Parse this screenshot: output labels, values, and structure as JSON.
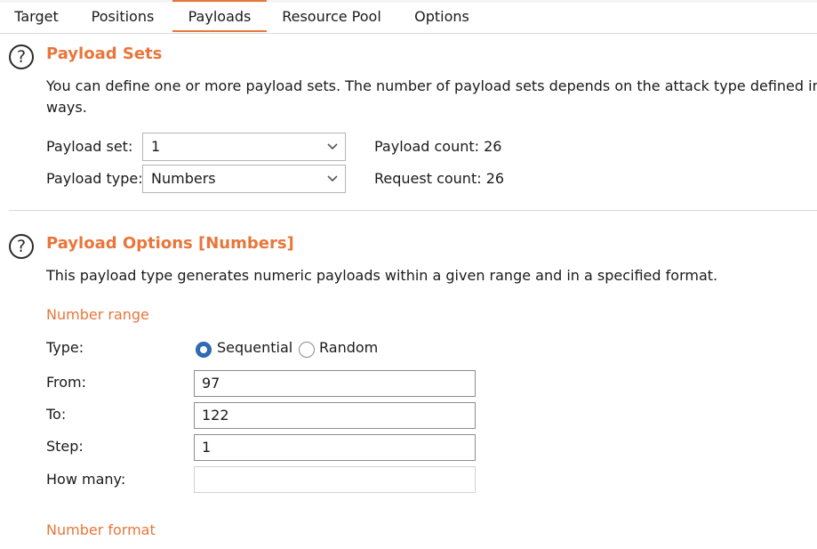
{
  "tabs": [
    {
      "label": "Target"
    },
    {
      "label": "Positions"
    },
    {
      "label": "Payloads"
    },
    {
      "label": "Resource Pool"
    },
    {
      "label": "Options"
    }
  ],
  "active_tab": "Payloads",
  "payload_sets": {
    "help_glyph": "?",
    "title": "Payload Sets",
    "description_line1": "You can define one or more payload sets. The number of payload sets depends on the attack type defined in the",
    "description_line2": "ways.",
    "set_label": "Payload set:",
    "set_value": "1",
    "type_label": "Payload type:",
    "type_value": "Numbers",
    "payload_count_label": "Payload count:",
    "payload_count": "26",
    "request_count_label": "Request count:",
    "request_count": "26"
  },
  "payload_options": {
    "help_glyph": "?",
    "title": "Payload Options [Numbers]",
    "description": "This payload type generates numeric payloads within a given range and in a specified format.",
    "number_range_title": "Number range",
    "type_label": "Type:",
    "type_options": [
      {
        "label": "Sequential",
        "selected": true
      },
      {
        "label": "Random",
        "selected": false
      }
    ],
    "from_label": "From:",
    "from_value": "97",
    "to_label": "To:",
    "to_value": "122",
    "step_label": "Step:",
    "step_value": "1",
    "how_many_label": "How many:",
    "how_many_value": "",
    "number_format_title": "Number format"
  },
  "colors": {
    "accent": "#e8763b",
    "radio_selected": "#2e6bb0"
  },
  "icons": [
    "help-icon",
    "chevron-down-icon"
  ]
}
